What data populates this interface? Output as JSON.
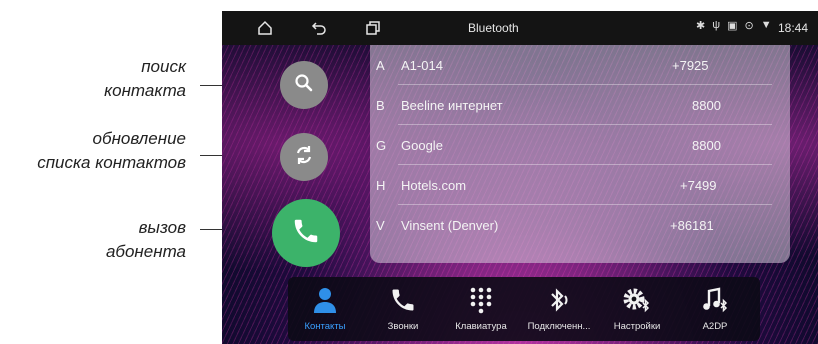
{
  "callouts": {
    "search": [
      "поиск",
      "контакта"
    ],
    "refresh": [
      "обновление",
      "списка контактов"
    ],
    "call": [
      "вызов",
      "абонента"
    ]
  },
  "statusbar": {
    "title": "Bluetooth",
    "time": "18:44",
    "icons": [
      "home-icon",
      "back-icon",
      "recent-apps-icon",
      "bluetooth-icon",
      "usb-icon",
      "sd-card-icon",
      "location-icon",
      "wifi-icon"
    ]
  },
  "contacts": [
    {
      "letter": "A",
      "name": "A1-014",
      "number": "+7925"
    },
    {
      "letter": "B",
      "name": "Beeline интернет",
      "number": "8800"
    },
    {
      "letter": "G",
      "name": "Google",
      "number": "8800"
    },
    {
      "letter": "H",
      "name": "Hotels.com",
      "number": "+7499"
    },
    {
      "letter": "V",
      "name": "Vinsent (Denver)",
      "number": "+86181"
    }
  ],
  "dock": {
    "items": [
      {
        "label": "Контакты",
        "icon": "person-icon",
        "active": true
      },
      {
        "label": "Звонки",
        "icon": "phone-icon",
        "active": false
      },
      {
        "label": "Клавиатура",
        "icon": "dialpad-icon",
        "active": false
      },
      {
        "label": "Подключенн...",
        "icon": "bluetooth-audio-icon",
        "active": false
      },
      {
        "label": "Настройки",
        "icon": "settings-bluetooth-icon",
        "active": false
      },
      {
        "label": "A2DP",
        "icon": "music-bluetooth-icon",
        "active": false
      }
    ]
  },
  "colors": {
    "call_button": "#3cb36a",
    "gray_button": "#8a8a8a",
    "active_tab": "#3aa0ff",
    "person_icon": "#2f8fe8"
  }
}
